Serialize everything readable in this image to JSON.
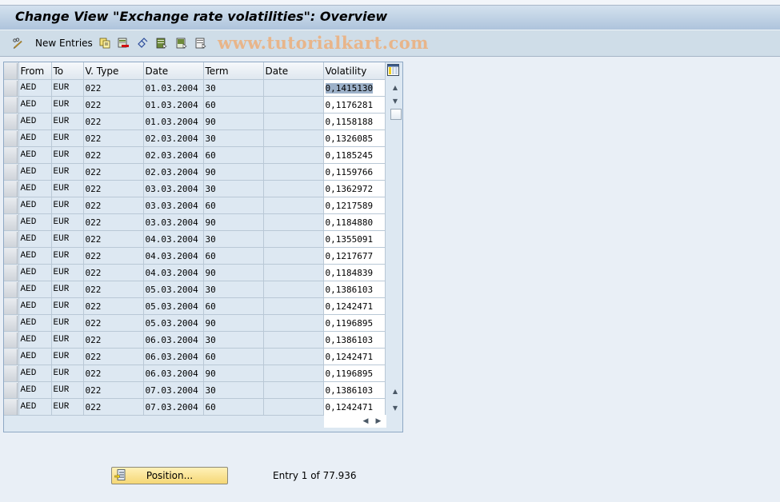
{
  "window": {
    "title": "Change View \"Exchange rate volatilities\": Overview"
  },
  "toolbar": {
    "new_entries_label": "New Entries",
    "watermark": "www.tutorialkart.com",
    "icons": [
      "edit-pencil-glasses-icon",
      "copy-icon",
      "delete-icon",
      "undo-icon",
      "select-all-icon",
      "select-block-icon",
      "deselect-all-icon"
    ]
  },
  "table": {
    "columns": [
      "From",
      "To",
      "V. Type",
      "Date",
      "Term",
      "Date",
      "Volatility"
    ],
    "rows": [
      [
        "AED",
        "EUR",
        "022",
        "01.03.2004",
        "30",
        "",
        "0,1415130"
      ],
      [
        "AED",
        "EUR",
        "022",
        "01.03.2004",
        "60",
        "",
        "0,1176281"
      ],
      [
        "AED",
        "EUR",
        "022",
        "01.03.2004",
        "90",
        "",
        "0,1158188"
      ],
      [
        "AED",
        "EUR",
        "022",
        "02.03.2004",
        "30",
        "",
        "0,1326085"
      ],
      [
        "AED",
        "EUR",
        "022",
        "02.03.2004",
        "60",
        "",
        "0,1185245"
      ],
      [
        "AED",
        "EUR",
        "022",
        "02.03.2004",
        "90",
        "",
        "0,1159766"
      ],
      [
        "AED",
        "EUR",
        "022",
        "03.03.2004",
        "30",
        "",
        "0,1362972"
      ],
      [
        "AED",
        "EUR",
        "022",
        "03.03.2004",
        "60",
        "",
        "0,1217589"
      ],
      [
        "AED",
        "EUR",
        "022",
        "03.03.2004",
        "90",
        "",
        "0,1184880"
      ],
      [
        "AED",
        "EUR",
        "022",
        "04.03.2004",
        "30",
        "",
        "0,1355091"
      ],
      [
        "AED",
        "EUR",
        "022",
        "04.03.2004",
        "60",
        "",
        "0,1217677"
      ],
      [
        "AED",
        "EUR",
        "022",
        "04.03.2004",
        "90",
        "",
        "0,1184839"
      ],
      [
        "AED",
        "EUR",
        "022",
        "05.03.2004",
        "30",
        "",
        "0,1386103"
      ],
      [
        "AED",
        "EUR",
        "022",
        "05.03.2004",
        "60",
        "",
        "0,1242471"
      ],
      [
        "AED",
        "EUR",
        "022",
        "05.03.2004",
        "90",
        "",
        "0,1196895"
      ],
      [
        "AED",
        "EUR",
        "022",
        "06.03.2004",
        "30",
        "",
        "0,1386103"
      ],
      [
        "AED",
        "EUR",
        "022",
        "06.03.2004",
        "60",
        "",
        "0,1242471"
      ],
      [
        "AED",
        "EUR",
        "022",
        "06.03.2004",
        "90",
        "",
        "0,1196895"
      ],
      [
        "AED",
        "EUR",
        "022",
        "07.03.2004",
        "30",
        "",
        "0,1386103"
      ],
      [
        "AED",
        "EUR",
        "022",
        "07.03.2004",
        "60",
        "",
        "0,1242471"
      ]
    ],
    "selected_cell_value": "0,1415130"
  },
  "footer": {
    "position_button_label": "Position...",
    "entry_text": "Entry 1 of 77.936"
  },
  "colors": {
    "title_gradient_top": "#d3e1ee",
    "toolbar_bg": "#cfdde8",
    "table_bg": "#dde8f2",
    "button_yellow": "#f5d775",
    "watermark": "#e8b58a"
  }
}
